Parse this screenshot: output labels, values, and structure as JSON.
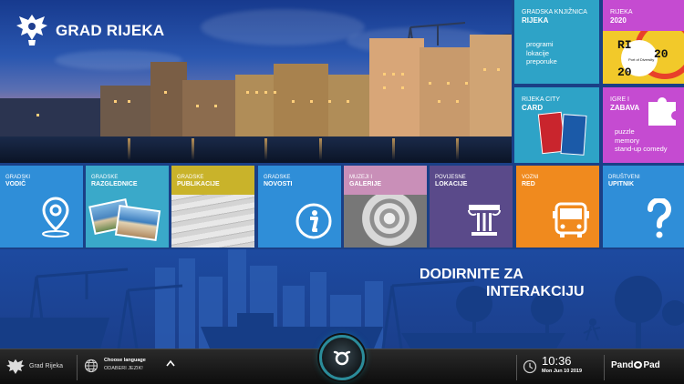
{
  "header": {
    "title": "GRAD RIJEKA"
  },
  "tiles": [
    {
      "id": "knjiznica",
      "category": "GRADSKA KNJIŽNICA",
      "name": "RIJEKA",
      "lines": [
        "programi",
        "lokacije",
        "preporuke"
      ],
      "color": "#2ea3c7"
    },
    {
      "id": "rijeka2020",
      "category": "RIJEKA",
      "name": "2020",
      "logo_text": [
        "RI",
        "20",
        "20"
      ],
      "logo_caption": "Port of Diversity",
      "color": "#f2c92a"
    },
    {
      "id": "citycard",
      "category": "RIJEKA CITY",
      "name": "CARD",
      "color": "#2ea3c7"
    },
    {
      "id": "igre",
      "category": "IGRE I",
      "name": "ZABAVA",
      "lines": [
        "puzzle",
        "memory",
        "stand-up comedy"
      ],
      "color": "#c54bd1"
    },
    {
      "id": "vodic",
      "category": "GRADSKI",
      "name": "VODIČ",
      "color": "#2f8ed8"
    },
    {
      "id": "razglednice",
      "category": "GRADSKE",
      "name": "RAZGLEDNICE",
      "color": "#3aa9c9"
    },
    {
      "id": "publikacije",
      "category": "GRADSKE",
      "name": "PUBLIKACIJE",
      "color": "#c9b32a"
    },
    {
      "id": "novosti",
      "category": "GRADSKE",
      "name": "NOVOSTI",
      "color": "#2f8ed8"
    },
    {
      "id": "muzeji",
      "category": "MUZEJI I",
      "name": "GALERIJE",
      "color": "#c98fb8"
    },
    {
      "id": "lokacije",
      "category": "POVIJESNE",
      "name": "LOKACIJE",
      "color": "#5a4a8a"
    },
    {
      "id": "vozni",
      "category": "VOZNI",
      "name": "RED",
      "color": "#f08a1e"
    },
    {
      "id": "upitnik",
      "category": "DRUŠTVENI",
      "name": "UPITNIK",
      "color": "#2f8ed8"
    }
  ],
  "banner": {
    "line1": "DODIRNITE ZA",
    "line2": "INTERAKCIJU"
  },
  "taskbar": {
    "city": "Grad Rijeka",
    "lang_title": "Choose language",
    "lang_sub": "ODABERI JEZIK!",
    "time": "10:36",
    "date": "Mon Jun 10 2019",
    "brand": "PandoPad",
    "brand_a": "Pand",
    "brand_b": "Pad"
  },
  "icons": {
    "vodic": "map-pin-icon",
    "novosti": "info-icon",
    "vozni": "bus-icon",
    "upitnik": "question-mark-icon",
    "igre": "puzzle-icon",
    "lokacije": "column-icon",
    "home": "pandopad-home-icon",
    "language": "globe-icon",
    "clock": "clock-icon",
    "chevron": "chevron-up-icon"
  }
}
